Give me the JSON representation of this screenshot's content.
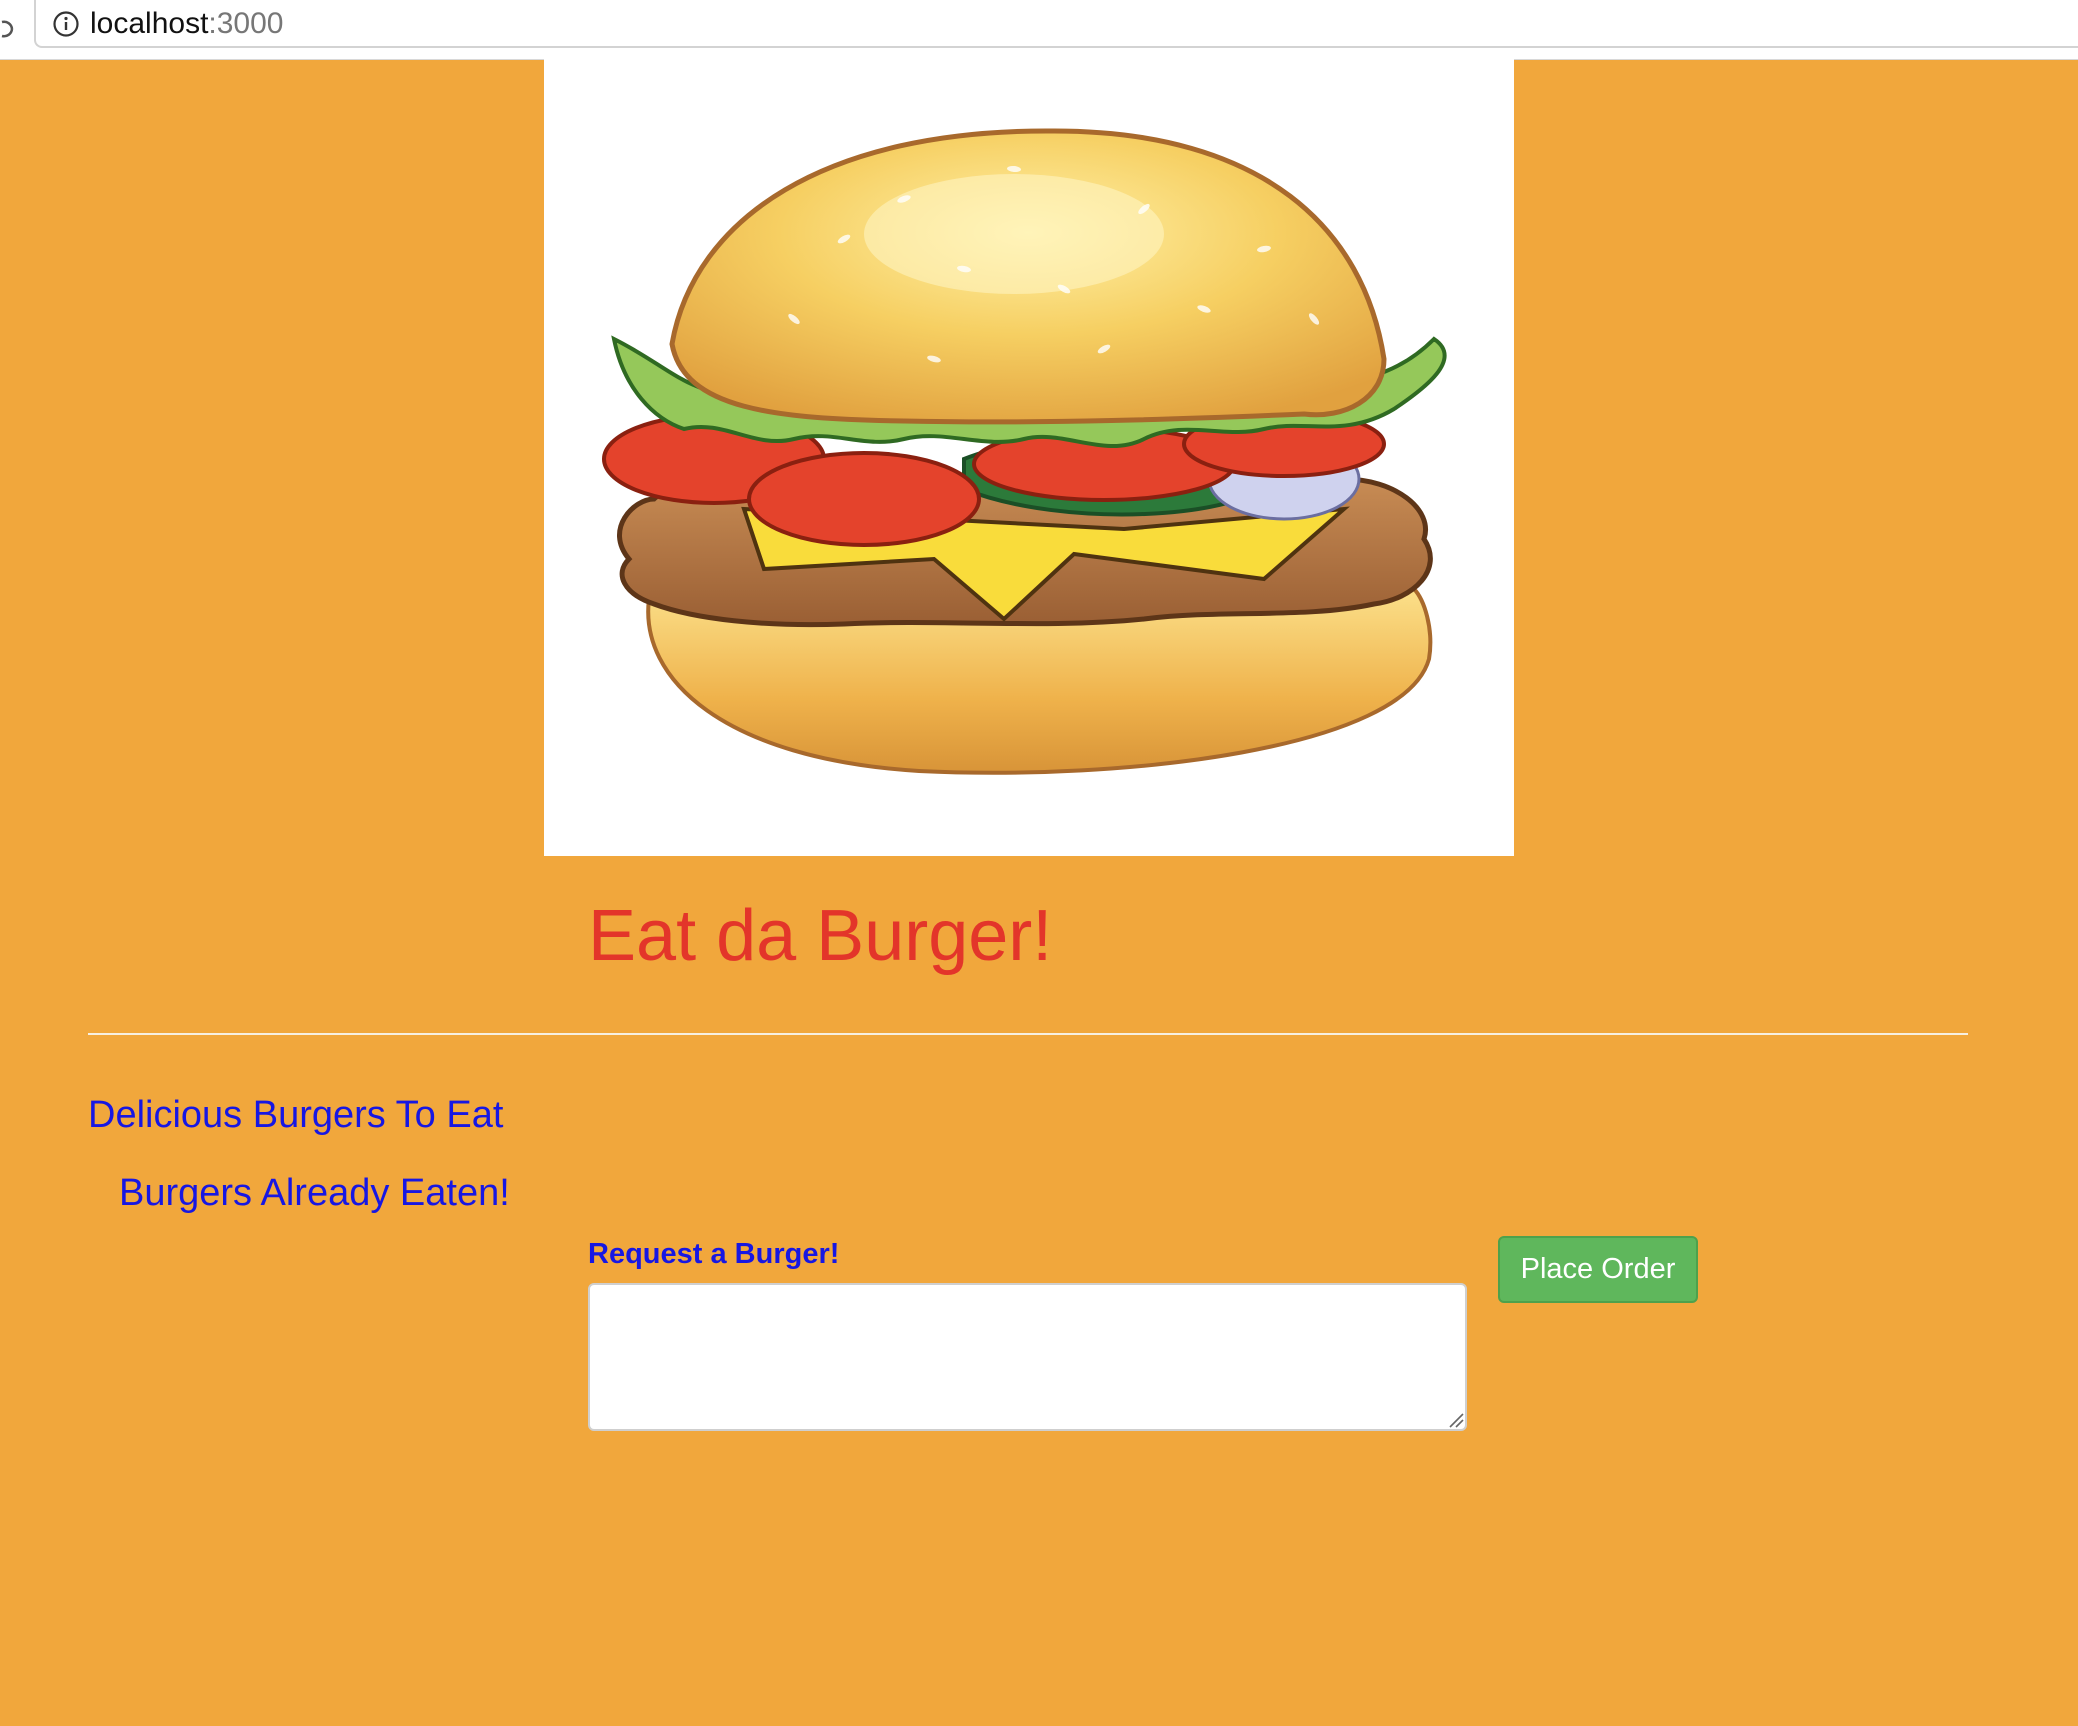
{
  "browser": {
    "url_host": "localhost",
    "url_port": ":3000"
  },
  "page": {
    "background_color": "#f1a73c",
    "hero_image_icon": "burger-illustration",
    "title": "Eat da Burger!",
    "title_color": "#e3352a",
    "sections": {
      "to_eat_heading": "Delicious Burgers To Eat",
      "eaten_heading": "Burgers Already Eaten!"
    },
    "heading_color": "#1717e3",
    "form": {
      "label": "Request a Burger!",
      "input_value": "",
      "submit_label": "Place Order",
      "submit_color": "#5fb75c"
    }
  }
}
